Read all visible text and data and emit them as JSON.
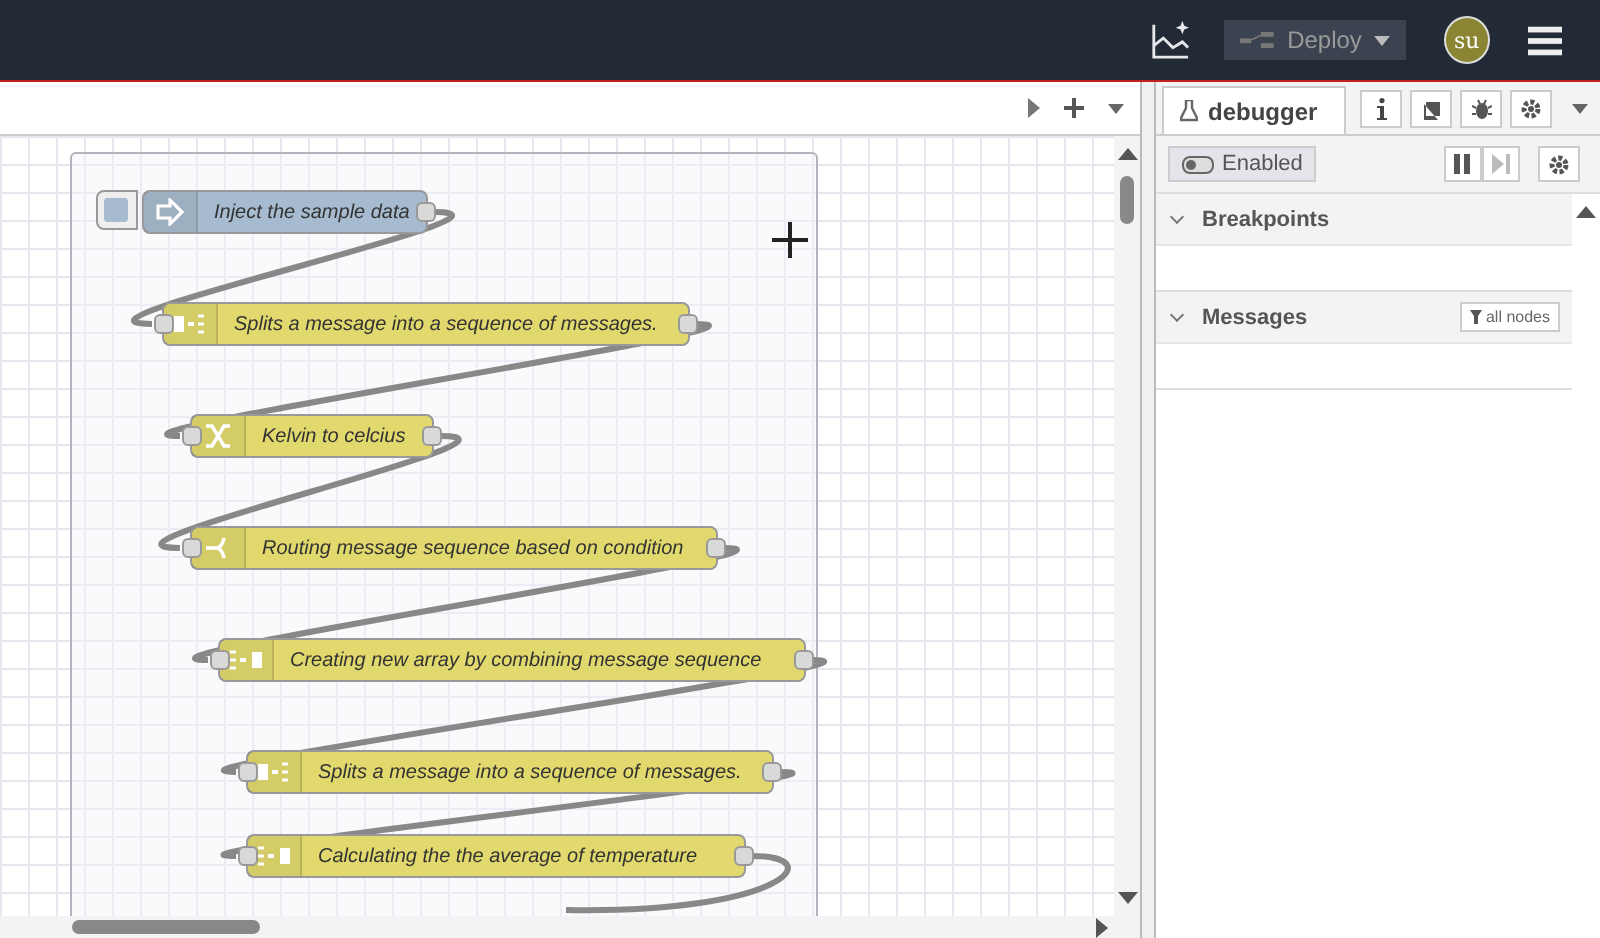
{
  "header": {
    "deploy": {
      "label": "Deploy",
      "disabled": true
    },
    "user": {
      "initials": "su"
    }
  },
  "canvas": {
    "nodes": [
      {
        "kind": "inject",
        "label": "Inject the sample data"
      },
      {
        "kind": "split",
        "label": "Splits a message into a sequence of messages."
      },
      {
        "kind": "change",
        "label": "Kelvin to celcius"
      },
      {
        "kind": "switch",
        "label": "Routing message sequence based on condition"
      },
      {
        "kind": "join",
        "label": "Creating new array by combining message sequence"
      },
      {
        "kind": "split",
        "label": "Splits a message into a sequence of messages."
      },
      {
        "kind": "join",
        "label": "Calculating the the average of temperature"
      }
    ]
  },
  "sidebar": {
    "tab": {
      "label": "debugger",
      "selected": true
    },
    "toggle": {
      "label": "Enabled",
      "on": true
    },
    "sections": [
      {
        "title": "Breakpoints"
      },
      {
        "title": "Messages",
        "filter": "all nodes"
      }
    ]
  }
}
